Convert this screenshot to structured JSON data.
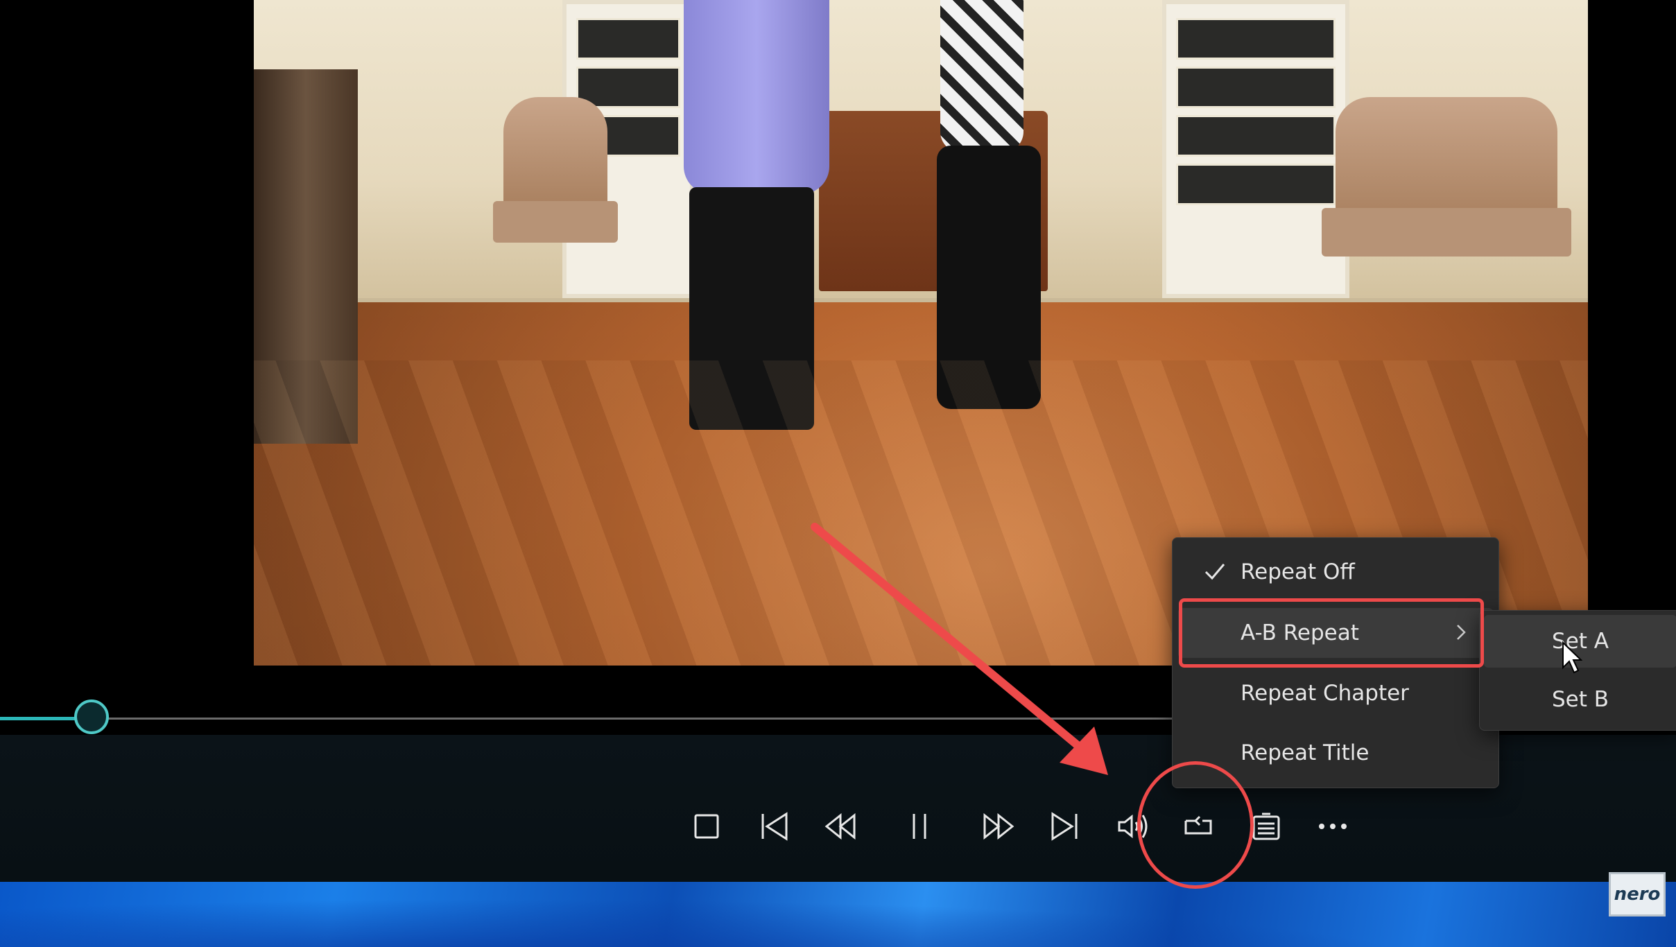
{
  "menu": {
    "items": [
      {
        "label": "Repeat Off",
        "checked": true
      },
      {
        "label": "A-B Repeat",
        "has_submenu": true,
        "highlighted": true
      },
      {
        "label": "Repeat Chapter"
      },
      {
        "label": "Repeat Title"
      }
    ]
  },
  "submenu": {
    "items": [
      {
        "label": "Set A"
      },
      {
        "label": "Set B"
      }
    ]
  },
  "player": {
    "progress_fraction": 0.08,
    "controls": [
      "stop-icon",
      "previous-icon",
      "rewind-icon",
      "pause-icon",
      "fast-forward-icon",
      "next-icon",
      "volume-icon",
      "repeat-icon",
      "playlist-icon",
      "more-icon"
    ]
  },
  "brand": {
    "logo_text": "nero"
  },
  "colors": {
    "accent": "#2cb7b8",
    "annotation": "#ee4a4a",
    "menu_bg": "#2b2b2b"
  }
}
